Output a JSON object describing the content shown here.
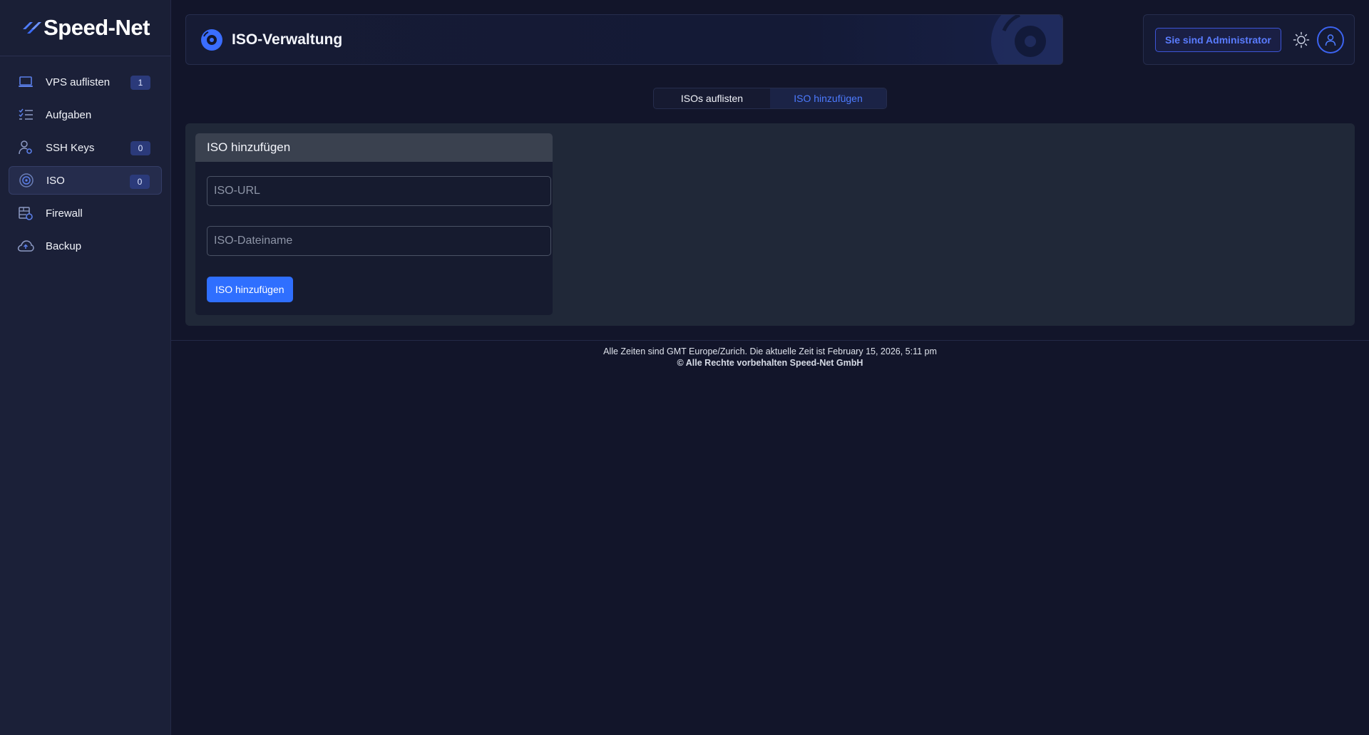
{
  "brand": {
    "name": "Speed-Net",
    "accent": "#3b6cff"
  },
  "sidebar": {
    "items": [
      {
        "label": "VPS auflisten",
        "icon": "laptop-icon",
        "badge": "1"
      },
      {
        "label": "Aufgaben",
        "icon": "task-list-icon"
      },
      {
        "label": "SSH Keys",
        "icon": "user-key-icon",
        "badge": "0"
      },
      {
        "label": "ISO",
        "icon": "disc-icon",
        "badge": "0",
        "active": true
      },
      {
        "label": "Firewall",
        "icon": "firewall-icon"
      },
      {
        "label": "Backup",
        "icon": "cloud-upload-icon"
      }
    ]
  },
  "header": {
    "title": "ISO-Verwaltung",
    "icon": "disc-icon"
  },
  "user": {
    "admin_label": "Sie sind Administrator",
    "theme_icon": "sun-icon",
    "avatar_icon": "user-icon"
  },
  "tabs": [
    {
      "label": "ISOs auflisten",
      "active": false
    },
    {
      "label": "ISO hinzufügen",
      "active": true
    }
  ],
  "form": {
    "title": "ISO hinzufügen",
    "url_placeholder": "ISO-URL",
    "url_value": "",
    "filename_placeholder": "ISO-Dateiname",
    "filename_value": "",
    "submit_label": "ISO hinzufügen"
  },
  "footer": {
    "time_note": "Alle Zeiten sind GMT Europe/Zurich. Die aktuelle Zeit ist February 15, 2026, 5:11 pm",
    "copyright": "© Alle Rechte vorbehalten Speed-Net GmbH"
  }
}
